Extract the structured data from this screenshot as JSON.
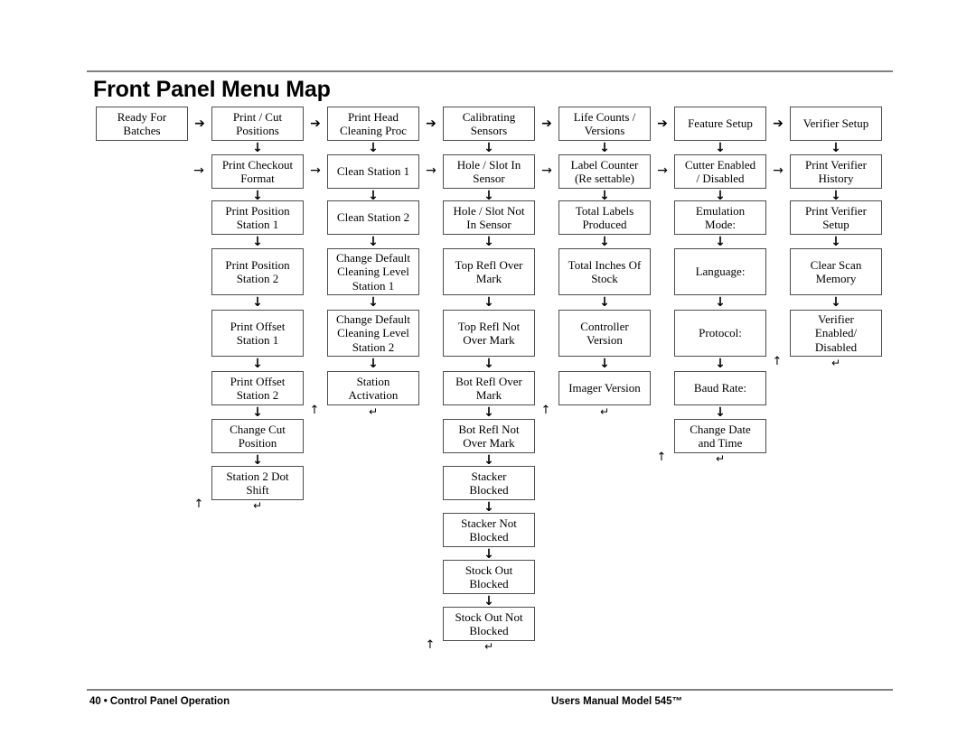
{
  "header": {
    "title": "Front Panel Menu Map"
  },
  "footer": {
    "page_number": "40",
    "bullet": "•",
    "section": "Control Panel Operation",
    "manual": "Users Manual Model 545™"
  },
  "glyphs": {
    "arrow_right_bold": "➔",
    "arrow_right_thin": "→",
    "arrow_down": "↓",
    "arrow_up": "↑",
    "return": "↵"
  },
  "colors": {
    "rule": "#808080",
    "box_border": "#4d4d4d",
    "text": "#000000",
    "background": "#ffffff"
  },
  "chart_data": {
    "type": "diagram",
    "title": "Front Panel Menu Map",
    "columns": [
      {
        "name": "ready",
        "nodes": [
          "Ready For\nBatches"
        ]
      },
      {
        "name": "print-cut-positions",
        "nodes": [
          "Print / Cut\nPositions",
          "Print Checkout\nFormat",
          "Print Position\nStation 1",
          "Print Position\nStation 2",
          "Print Offset\nStation 1",
          "Print Offset\nStation 2",
          "Change Cut\nPosition",
          "Station 2 Dot\nShift"
        ]
      },
      {
        "name": "print-head-cleaning",
        "nodes": [
          "Print Head\nCleaning Proc",
          "Clean Station 1",
          "Clean Station 2",
          "Change Default\nCleaning Level\nStation 1",
          "Change Default\nCleaning Level\nStation 2",
          "Station\nActivation"
        ]
      },
      {
        "name": "calibrating-sensors",
        "nodes": [
          "Calibrating\nSensors",
          "Hole / Slot In\nSensor",
          "Hole / Slot Not\nIn Sensor",
          "Top Refl Over\nMark",
          "Top Refl Not\nOver Mark",
          "Bot Refl Over\nMark",
          "Bot Refl Not\nOver Mark",
          "Stacker\nBlocked",
          "Stacker Not\nBlocked",
          "Stock Out\nBlocked",
          "Stock Out Not\nBlocked"
        ]
      },
      {
        "name": "life-counts-versions",
        "nodes": [
          "Life Counts /\nVersions",
          "Label Counter\n(Re settable)",
          "Total Labels\nProduced",
          "Total Inches Of\nStock",
          "Controller\nVersion",
          "Imager Version"
        ]
      },
      {
        "name": "feature-setup",
        "nodes": [
          "Feature Setup",
          "Cutter Enabled\n/ Disabled",
          "Emulation\nMode:",
          "Language:",
          "Protocol:",
          "Baud Rate:",
          "Change Date\nand Time"
        ]
      },
      {
        "name": "verifier-setup",
        "nodes": [
          "Verifier Setup",
          "Print Verifier\nHistory",
          "Print Verifier\nSetup",
          "Clear Scan\nMemory",
          "Verifier\nEnabled/\nDisabled"
        ]
      }
    ]
  }
}
